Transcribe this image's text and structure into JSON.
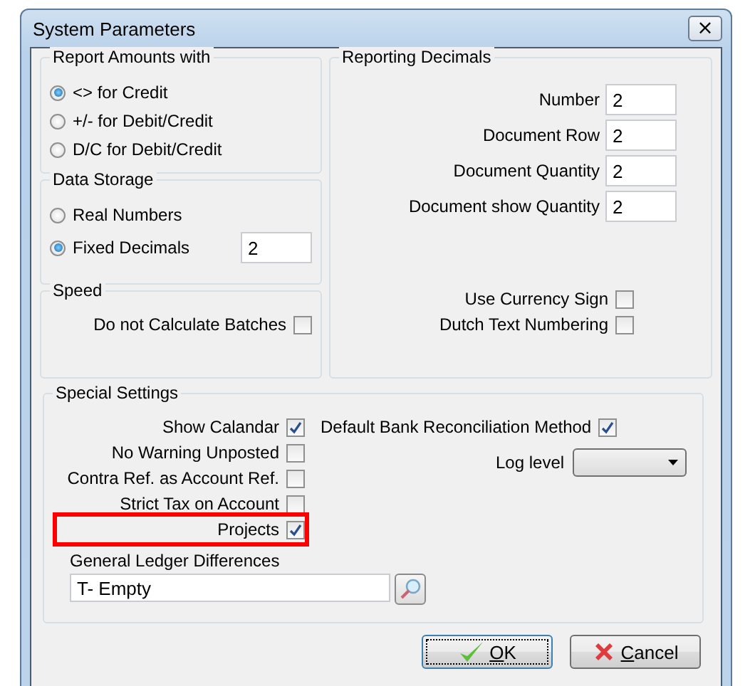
{
  "window": {
    "title": "System Parameters",
    "close": "×"
  },
  "report_amounts": {
    "title": "Report Amounts with",
    "options": [
      {
        "label": "<>  for Credit",
        "selected": true
      },
      {
        "label": "+/-  for Debit/Credit",
        "selected": false
      },
      {
        "label": "D/C for Debit/Credit",
        "selected": false
      }
    ]
  },
  "data_storage": {
    "title": "Data Storage",
    "options": [
      {
        "label": "Real Numbers",
        "selected": false
      },
      {
        "label": "Fixed Decimals",
        "selected": true,
        "value": "2"
      }
    ]
  },
  "speed": {
    "title": "Speed",
    "checkboxes": [
      {
        "label": "Do not Calculate Batches",
        "checked": false
      }
    ]
  },
  "reporting_decimals": {
    "title": "Reporting Decimals",
    "fields": [
      {
        "label": "Number",
        "value": "2"
      },
      {
        "label": "Document Row",
        "value": "2"
      },
      {
        "label": "Document Quantity",
        "value": "2"
      },
      {
        "label": "Document show Quantity",
        "value": "2"
      }
    ],
    "checkboxes": [
      {
        "label": "Use Currency Sign",
        "checked": false
      },
      {
        "label": "Dutch Text Numbering",
        "checked": false
      }
    ]
  },
  "special_settings": {
    "title": "Special Settings",
    "checkboxes": [
      {
        "label": "Show Calandar",
        "checked": true,
        "highlighted": false
      },
      {
        "label": "No Warning Unposted",
        "checked": false,
        "highlighted": false
      },
      {
        "label": "Contra Ref. as Account Ref.",
        "checked": false,
        "highlighted": false
      },
      {
        "label": "Strict Tax on Account",
        "checked": false,
        "highlighted": false
      },
      {
        "label": "Projects",
        "checked": true,
        "highlighted": true
      }
    ],
    "bank_reconciliation": {
      "label": "Default Bank Reconciliation Method",
      "checked": true
    },
    "log_level": {
      "label": "Log level"
    },
    "ledger_differences": {
      "label": "General Ledger Differences",
      "value": "T- Empty"
    }
  },
  "buttons": [
    {
      "label": "OK",
      "kind": "ok",
      "focused": true
    },
    {
      "label": "Cancel",
      "kind": "cancel",
      "focused": false
    }
  ]
}
